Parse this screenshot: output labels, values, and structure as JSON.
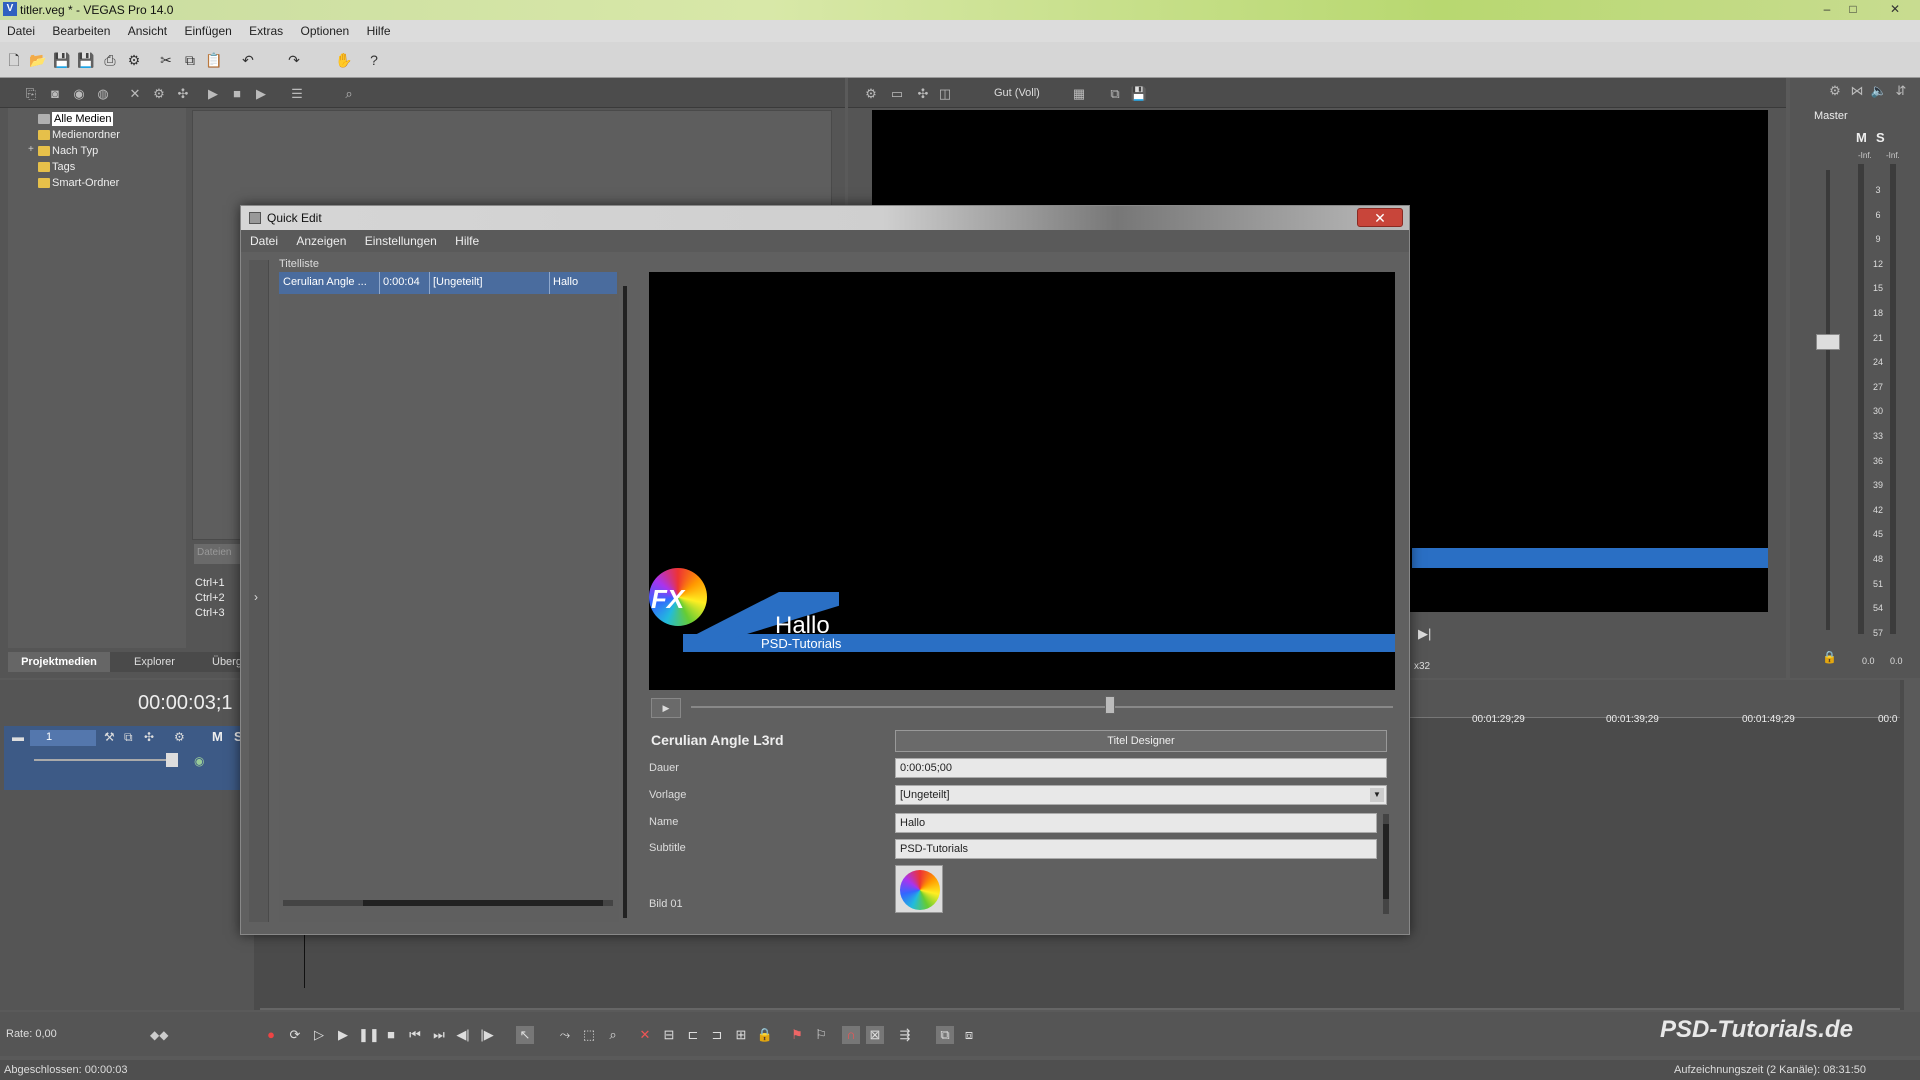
{
  "window": {
    "title": "titler.veg * - VEGAS Pro 14.0",
    "minimize": "–",
    "maximize": "□",
    "close": "✕"
  },
  "menu": [
    "Datei",
    "Bearbeiten",
    "Ansicht",
    "Einfügen",
    "Extras",
    "Optionen",
    "Hilfe"
  ],
  "media_tree": {
    "items": [
      "Alle Medien",
      "Medienordner",
      "Nach Typ",
      "Tags",
      "Smart-Ordner"
    ],
    "expander": "+"
  },
  "media_panel": {
    "search_placeholder": "Dateien",
    "shortcuts": [
      "Ctrl+1",
      "Ctrl+2",
      "Ctrl+3"
    ],
    "tabs": [
      "Projektmedien",
      "Explorer",
      "Überg"
    ]
  },
  "preview": {
    "quality": "Gut (Voll)",
    "frame_info": "x32"
  },
  "master": {
    "label": "Master",
    "m": "M",
    "s": "S",
    "inf_left": "-Inf.",
    "inf_right": "-Inf.",
    "scale": [
      "3",
      "6",
      "9",
      "12",
      "15",
      "18",
      "21",
      "24",
      "27",
      "30",
      "33",
      "36",
      "39",
      "42",
      "45",
      "48",
      "51",
      "54",
      "57"
    ],
    "val_left": "0.0",
    "val_right": "0.0"
  },
  "timecode": "00:00:03;1",
  "track": {
    "number": "1",
    "m": "M",
    "s": "S"
  },
  "timeline": {
    "ticks": [
      "00:01:29;29",
      "00:01:39;29",
      "00:01:49;29",
      "00:0"
    ]
  },
  "dialog": {
    "title": "Quick Edit",
    "close": "✕",
    "menu": [
      "Datei",
      "Anzeigen",
      "Einstellungen",
      "Hilfe"
    ],
    "list_header": "Titelliste",
    "list_row": [
      "Cerulian Angle ...",
      "0:00:04",
      "[Ungeteilt]",
      "Hallo"
    ],
    "preview_title": "Hallo",
    "preview_subtitle": "PSD-Tutorials",
    "preview_logo": "FX",
    "item_title": "Cerulian Angle L3rd",
    "designer_button": "Titel Designer",
    "fields": {
      "dauer_label": "Dauer",
      "dauer_value": "0:00:05;00",
      "vorlage_label": "Vorlage",
      "vorlage_value": "[Ungeteilt]",
      "name_label": "Name",
      "name_value": "Hallo",
      "subtitle_label": "Subtitle",
      "subtitle_value": "PSD-Tutorials",
      "bild_label": "Bild 01"
    }
  },
  "transport": {
    "rate": "Rate: 0,00",
    "watermark": "PSD-Tutorials.de"
  },
  "status": {
    "left": "Abgeschlossen: 00:00:03",
    "right": "Aufzeichnungszeit (2 Kanäle): 08:31:50"
  }
}
